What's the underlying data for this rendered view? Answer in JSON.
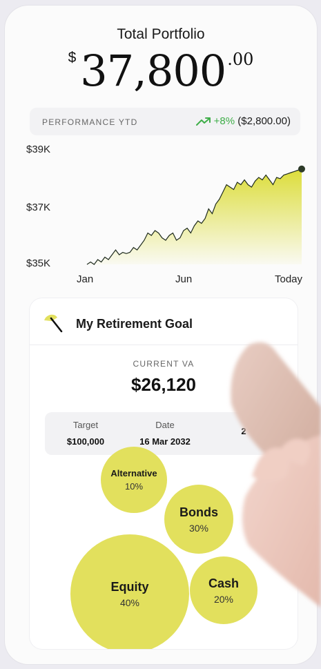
{
  "header": {
    "title": "Total Portfolio",
    "currency_symbol": "$",
    "amount_whole": "37,800",
    "amount_cents": ".00"
  },
  "performance": {
    "label": "PERFORMANCE YTD",
    "percent": "+8%",
    "amount": "($2,800.00)",
    "trend_icon": "trending-up-icon",
    "positive_color": "#3fae49"
  },
  "chart_data": {
    "type": "area",
    "y_tick_labels": [
      "$39K",
      "$37K",
      "$35K"
    ],
    "x_tick_labels": [
      "Jan",
      "Jun",
      "Today"
    ],
    "ylim": [
      35000,
      39000
    ],
    "grid": false,
    "fill_color": "#dcdd3a",
    "line_color": "#1f2b1f",
    "series": [
      {
        "values": [
          35000,
          35100,
          35000,
          35200,
          35100,
          35300,
          35200,
          35400,
          35600,
          35400,
          35500,
          35450,
          35500,
          35700,
          35600,
          35800,
          36000,
          36300,
          36200,
          36400,
          36300,
          36100,
          36000,
          36200,
          36300,
          36000,
          36100,
          36400,
          36500,
          36300,
          36600,
          36800,
          36700,
          36900,
          37300,
          37100,
          37500,
          37700,
          38000,
          38300,
          38200,
          38100,
          38400,
          38300,
          38500,
          38300,
          38200,
          38450,
          38600,
          38500,
          38700,
          38500,
          38300,
          38600,
          38550,
          38700,
          38750,
          38800,
          38850,
          38900,
          38950
        ]
      }
    ]
  },
  "goal": {
    "icon": "umbrella-icon",
    "title": "My Retirement Goal",
    "current_label": "CURRENT VA",
    "current_value": "$26,120",
    "stats": [
      {
        "label": "Target",
        "value": "$100,000"
      },
      {
        "label": "Date",
        "value": "16 Mar 2032"
      },
      {
        "label": "",
        "value": "2"
      }
    ],
    "allocation": [
      {
        "name": "Alternative",
        "percent": "10%"
      },
      {
        "name": "Bonds",
        "percent": "30%"
      },
      {
        "name": "Equity",
        "percent": "40%"
      },
      {
        "name": "Cash",
        "percent": "20%"
      }
    ],
    "bubble_color": "#e2e05d"
  }
}
